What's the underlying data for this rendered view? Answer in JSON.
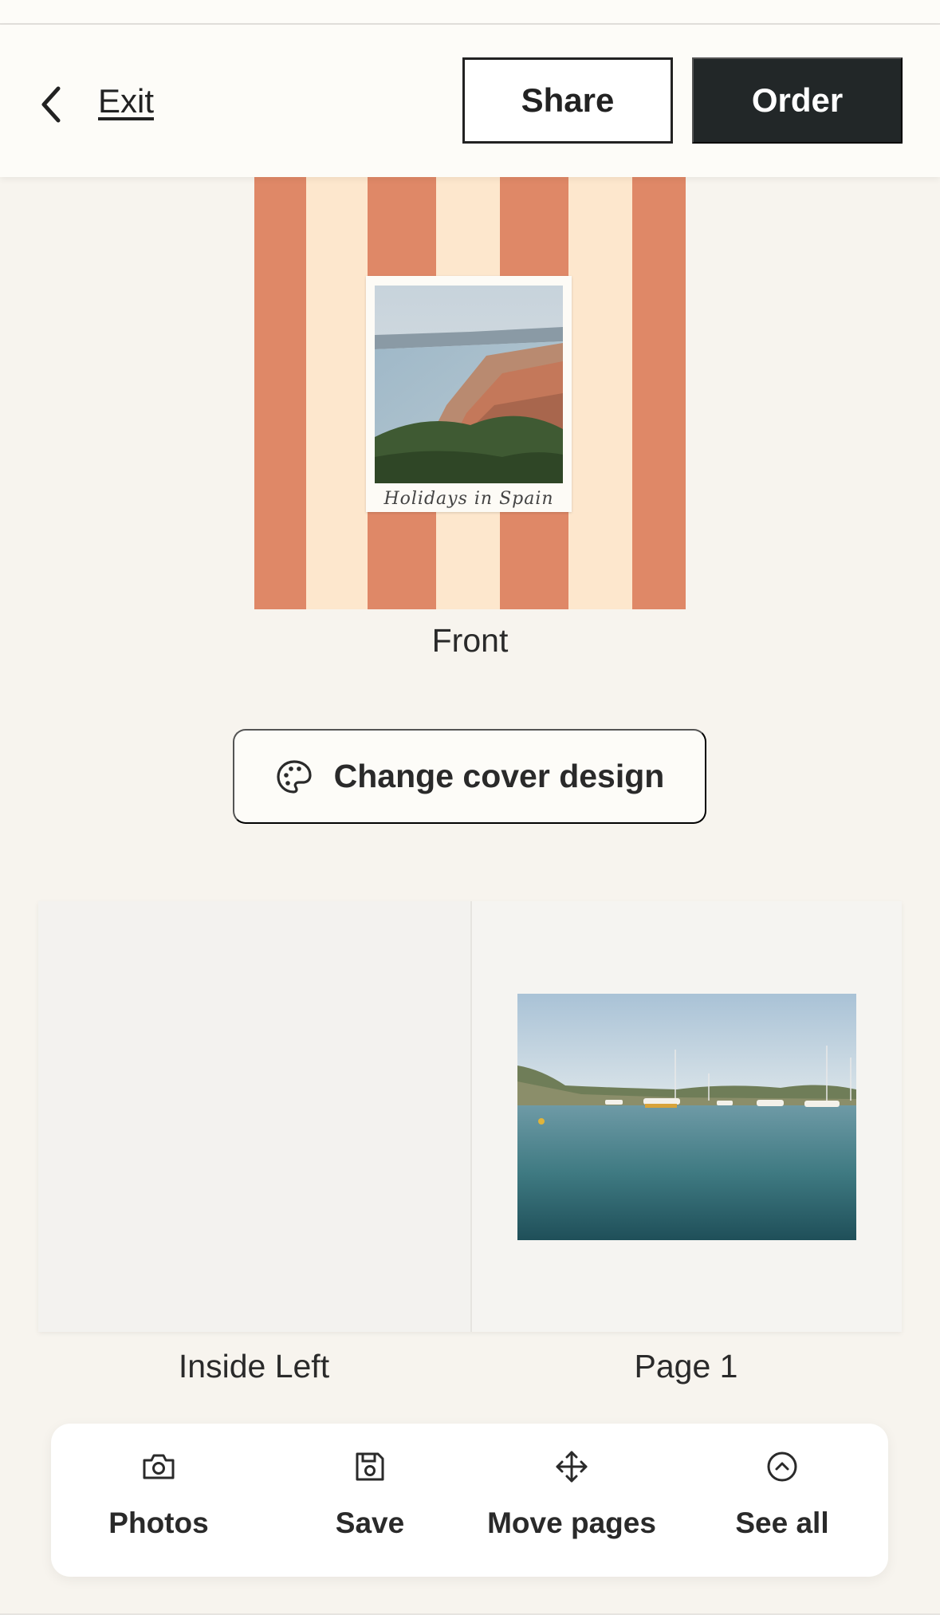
{
  "header": {
    "exit_label": "Exit",
    "share_label": "Share",
    "order_label": "Order"
  },
  "cover": {
    "caption": "Holidays in Spain",
    "label": "Front"
  },
  "change_cover": {
    "label": "Change cover design",
    "icon": "palette-icon"
  },
  "spread": {
    "left_label": "Inside Left",
    "right_label": "Page 1"
  },
  "toolbar": {
    "items": [
      {
        "label": "Photos",
        "icon": "camera-icon"
      },
      {
        "label": "Save",
        "icon": "save-icon"
      },
      {
        "label": "Move pages",
        "icon": "move-icon"
      },
      {
        "label": "See all",
        "icon": "chevron-up-circle-icon"
      }
    ]
  },
  "colors": {
    "accent_dark": "#222728",
    "stripe": "#df8867",
    "cream": "#fde7cd",
    "background": "#f7f4ee"
  }
}
